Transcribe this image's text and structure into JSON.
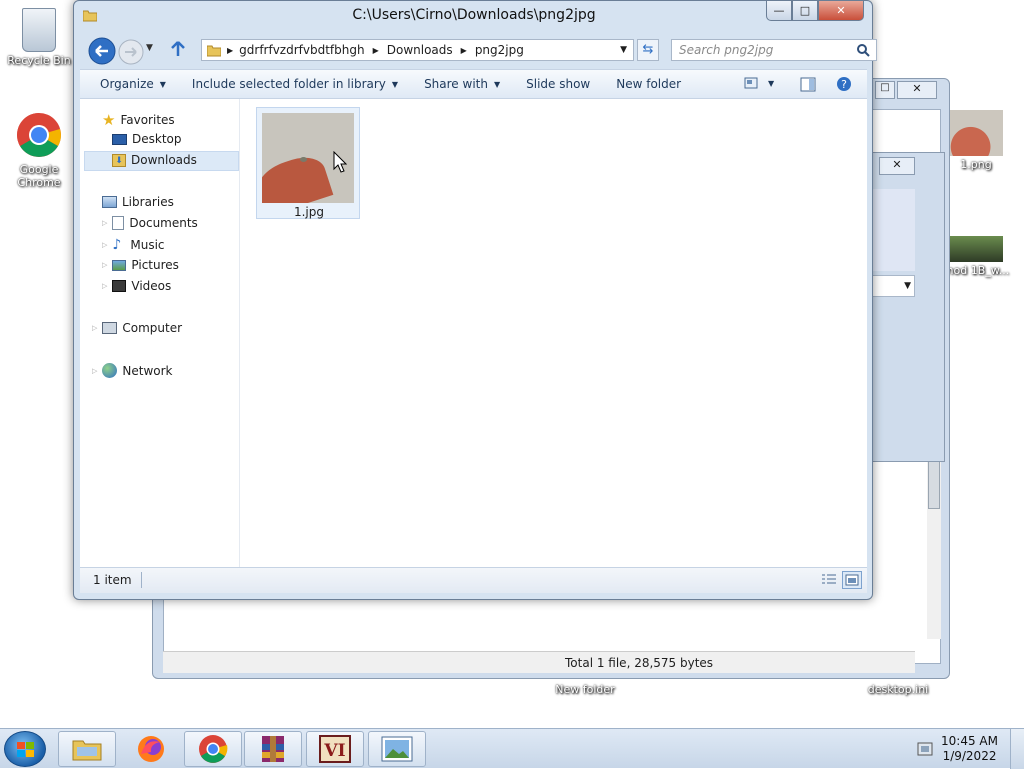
{
  "desktop": {
    "recycle_bin": "Recycle Bin",
    "chrome": "Google Chrome",
    "file_1png": "1.png",
    "file_video": "mod 1B_w...",
    "new_folder": "New folder",
    "desktop_ini": "desktop.ini"
  },
  "back_window": {
    "status_text": "Total 1 file, 28,575 bytes"
  },
  "explorer": {
    "title": "C:\\Users\\Cirno\\Downloads\\png2jpg",
    "caption_buttons": {
      "minimize": "—",
      "maximize": "□",
      "close": "✕"
    },
    "breadcrumb": [
      "gdrfrfvzdrfvbdtfbhgh",
      "Downloads",
      "png2jpg"
    ],
    "search_placeholder": "Search png2jpg",
    "toolbar": {
      "organize": "Organize",
      "include_library": "Include selected folder in library",
      "share_with": "Share with",
      "slide_show": "Slide show",
      "new_folder": "New folder"
    },
    "nav": {
      "favorites": "Favorites",
      "desktop": "Desktop",
      "downloads": "Downloads",
      "libraries": "Libraries",
      "documents": "Documents",
      "music": "Music",
      "pictures": "Pictures",
      "videos": "Videos",
      "computer": "Computer",
      "network": "Network"
    },
    "files": [
      {
        "name": "1.jpg"
      }
    ],
    "status": {
      "item_count": "1 item"
    }
  },
  "taskbar": {
    "time": "10:45 AM",
    "date": "1/9/2022"
  },
  "colors": {
    "accent": "#1e395b",
    "selection": "#dce9f7",
    "chrome_red": "#db4437",
    "chrome_green": "#0f9d58",
    "chrome_yellow": "#f4b400",
    "chrome_blue": "#4285f4"
  }
}
